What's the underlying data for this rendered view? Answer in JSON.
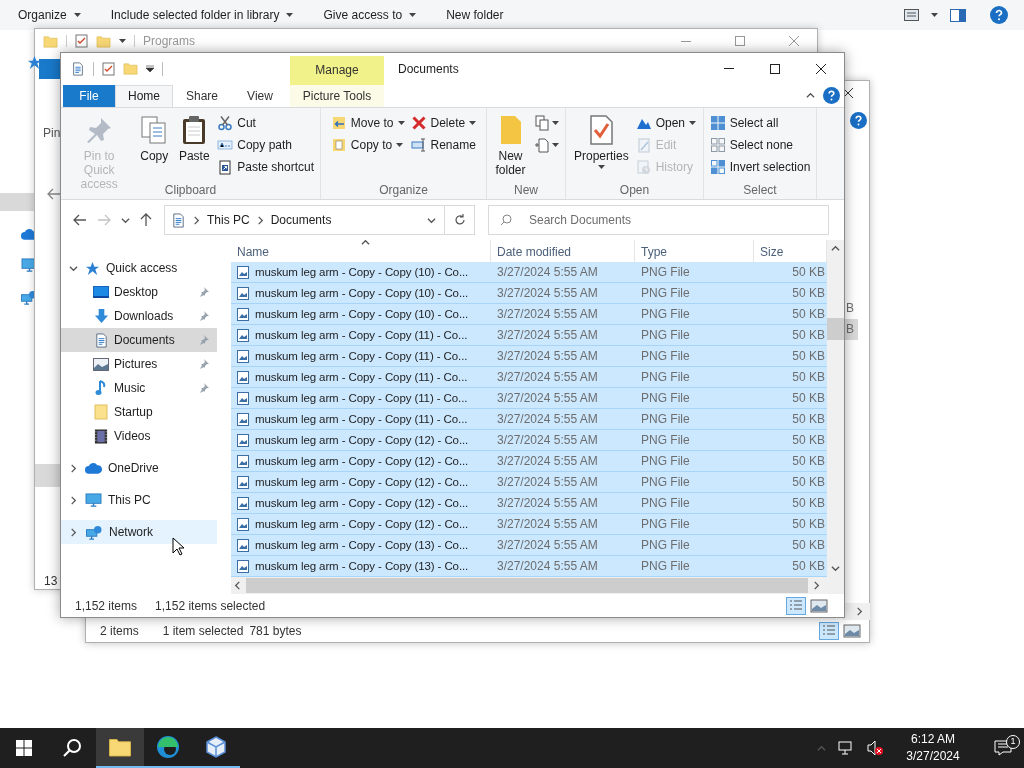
{
  "background_window": {
    "toolbar": [
      {
        "label": "Organize",
        "dropdown": true
      },
      {
        "label": "Include selected folder in library",
        "dropdown": true
      },
      {
        "label": "Give access to",
        "dropdown": true
      },
      {
        "label": "New folder",
        "dropdown": false
      }
    ]
  },
  "programs_window": {
    "title": "Programs",
    "ribbon_fragment": "Pin",
    "status_fragment": "13"
  },
  "second_window": {
    "size_fragments": [
      {
        "text": "B",
        "selected": false
      },
      {
        "text": "B",
        "selected": true
      }
    ],
    "status": [
      "2 items",
      "1 item selected",
      "781 bytes"
    ]
  },
  "explorer": {
    "title": "Documents",
    "context_tab": "Manage",
    "tabs": [
      {
        "label": "File",
        "kind": "file",
        "selected": false
      },
      {
        "label": "Home",
        "kind": "tab",
        "selected": true
      },
      {
        "label": "Share",
        "kind": "tab",
        "selected": false
      },
      {
        "label": "View",
        "kind": "tab",
        "selected": false
      },
      {
        "label": "Picture Tools",
        "kind": "context",
        "selected": false
      }
    ],
    "ribbon": [
      {
        "name": "Clipboard",
        "columns": [
          [
            {
              "label": "Pin to Quick access",
              "kind": "large",
              "disabled": true,
              "dropdown": false
            }
          ],
          [
            {
              "label": "Copy",
              "kind": "large",
              "disabled": false,
              "dropdown": false
            }
          ],
          [
            {
              "label": "Paste",
              "kind": "large",
              "disabled": false,
              "dropdown": false
            }
          ],
          [
            {
              "label": "Cut",
              "kind": "small",
              "disabled": false,
              "dropdown": false
            },
            {
              "label": "Copy path",
              "kind": "small",
              "disabled": false,
              "dropdown": false
            },
            {
              "label": "Paste shortcut",
              "kind": "small",
              "disabled": false,
              "dropdown": false
            }
          ]
        ]
      },
      {
        "name": "Organize",
        "columns": [
          [
            {
              "label": "Move to",
              "kind": "small",
              "disabled": false,
              "dropdown": true
            },
            {
              "label": "Copy to",
              "kind": "small",
              "disabled": false,
              "dropdown": true
            }
          ],
          [
            {
              "label": "Delete",
              "kind": "small",
              "disabled": false,
              "dropdown": true
            },
            {
              "label": "Rename",
              "kind": "small",
              "disabled": false,
              "dropdown": false
            }
          ]
        ]
      },
      {
        "name": "New",
        "columns": [
          [
            {
              "label": "New folder",
              "kind": "large",
              "disabled": false,
              "dropdown": false
            }
          ],
          [
            {
              "kind": "icon",
              "disabled": false,
              "dropdown": true
            },
            {
              "kind": "icon",
              "disabled": false,
              "dropdown": true
            }
          ]
        ]
      },
      {
        "name": "Open",
        "columns": [
          [
            {
              "label": "Properties",
              "kind": "large",
              "disabled": false,
              "dropdown": true
            }
          ],
          [
            {
              "label": "Open",
              "kind": "small",
              "disabled": false,
              "dropdown": true
            },
            {
              "label": "Edit",
              "kind": "small",
              "disabled": true,
              "dropdown": false
            },
            {
              "label": "History",
              "kind": "small",
              "disabled": true,
              "dropdown": false
            }
          ]
        ]
      },
      {
        "name": "Select",
        "columns": [
          [
            {
              "label": "Select all",
              "kind": "small",
              "disabled": false,
              "dropdown": false
            },
            {
              "label": "Select none",
              "kind": "small",
              "disabled": false,
              "dropdown": false
            },
            {
              "label": "Invert selection",
              "kind": "small",
              "disabled": false,
              "dropdown": false
            }
          ]
        ]
      }
    ],
    "crumbs": [
      "This PC",
      "Documents"
    ],
    "search_placeholder": "Search Documents",
    "nav": [
      {
        "label": "Quick access",
        "expanded": true,
        "selected": false,
        "hovered": false,
        "children": [
          {
            "label": "Desktop",
            "pinned": true,
            "selected": false
          },
          {
            "label": "Downloads",
            "pinned": true,
            "selected": false
          },
          {
            "label": "Documents",
            "pinned": true,
            "selected": true
          },
          {
            "label": "Pictures",
            "pinned": true,
            "selected": false
          },
          {
            "label": "Music",
            "pinned": true,
            "selected": false
          },
          {
            "label": "Startup",
            "pinned": false,
            "selected": false
          },
          {
            "label": "Videos",
            "pinned": false,
            "selected": false
          }
        ]
      },
      {
        "label": "OneDrive",
        "expanded": false,
        "selected": false,
        "hovered": false
      },
      {
        "label": "This PC",
        "expanded": false,
        "selected": false,
        "hovered": false
      },
      {
        "label": "Network",
        "expanded": false,
        "selected": false,
        "hovered": true
      }
    ],
    "columns": [
      {
        "label": "Name",
        "sorted": true
      },
      {
        "label": "Date modified",
        "sorted": false
      },
      {
        "label": "Type",
        "sorted": false
      },
      {
        "label": "Size",
        "sorted": false
      }
    ],
    "rows": [
      {
        "name": "muskum leg arm - Copy - Copy (10) - Co...",
        "date": "3/27/2024 5:55 AM",
        "type": "PNG File",
        "size": "50 KB",
        "selected": true
      },
      {
        "name": "muskum leg arm - Copy - Copy (10) - Co...",
        "date": "3/27/2024 5:55 AM",
        "type": "PNG File",
        "size": "50 KB",
        "selected": true
      },
      {
        "name": "muskum leg arm - Copy - Copy (10) - Co...",
        "date": "3/27/2024 5:55 AM",
        "type": "PNG File",
        "size": "50 KB",
        "selected": true
      },
      {
        "name": "muskum leg arm - Copy - Copy (11) - Co...",
        "date": "3/27/2024 5:55 AM",
        "type": "PNG File",
        "size": "50 KB",
        "selected": true
      },
      {
        "name": "muskum leg arm - Copy - Copy (11) - Co...",
        "date": "3/27/2024 5:55 AM",
        "type": "PNG File",
        "size": "50 KB",
        "selected": true
      },
      {
        "name": "muskum leg arm - Copy - Copy (11) - Co...",
        "date": "3/27/2024 5:55 AM",
        "type": "PNG File",
        "size": "50 KB",
        "selected": true
      },
      {
        "name": "muskum leg arm - Copy - Copy (11) - Co...",
        "date": "3/27/2024 5:55 AM",
        "type": "PNG File",
        "size": "50 KB",
        "selected": true
      },
      {
        "name": "muskum leg arm - Copy - Copy (11) - Co...",
        "date": "3/27/2024 5:55 AM",
        "type": "PNG File",
        "size": "50 KB",
        "selected": true
      },
      {
        "name": "muskum leg arm - Copy - Copy (12) - Co...",
        "date": "3/27/2024 5:55 AM",
        "type": "PNG File",
        "size": "50 KB",
        "selected": true
      },
      {
        "name": "muskum leg arm - Copy - Copy (12) - Co...",
        "date": "3/27/2024 5:55 AM",
        "type": "PNG File",
        "size": "50 KB",
        "selected": true
      },
      {
        "name": "muskum leg arm - Copy - Copy (12) - Co...",
        "date": "3/27/2024 5:55 AM",
        "type": "PNG File",
        "size": "50 KB",
        "selected": true
      },
      {
        "name": "muskum leg arm - Copy - Copy (12) - Co...",
        "date": "3/27/2024 5:55 AM",
        "type": "PNG File",
        "size": "50 KB",
        "selected": true
      },
      {
        "name": "muskum leg arm - Copy - Copy (12) - Co...",
        "date": "3/27/2024 5:55 AM",
        "type": "PNG File",
        "size": "50 KB",
        "selected": true
      },
      {
        "name": "muskum leg arm - Copy - Copy (13) - Co...",
        "date": "3/27/2024 5:55 AM",
        "type": "PNG File",
        "size": "50 KB",
        "selected": true
      },
      {
        "name": "muskum leg arm - Copy - Copy (13) - Co...",
        "date": "3/27/2024 5:55 AM",
        "type": "PNG File",
        "size": "50 KB",
        "selected": true
      }
    ],
    "status": [
      "1,152 items",
      "1,152 items selected"
    ]
  },
  "taskbar": {
    "apps": [
      {
        "active": true
      },
      {
        "active": false
      },
      {
        "active": false
      }
    ],
    "time": "6:12 AM",
    "date": "3/27/2024",
    "notifications": "1"
  }
}
